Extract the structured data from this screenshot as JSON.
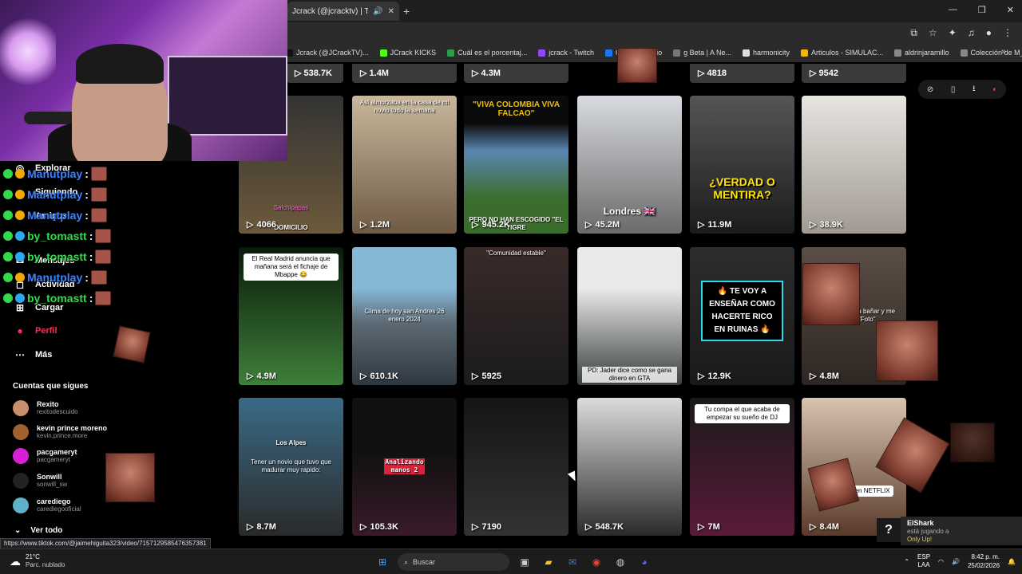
{
  "browser": {
    "tab_title": "Jcrack (@jcracktv) | TikTok",
    "bookmarks": [
      {
        "label": "Jcrack (@JCrackTV)...",
        "color": "#111111"
      },
      {
        "label": "JCrack KICKS",
        "color": "#53fc18"
      },
      {
        "label": "Cuál es el porcentaj...",
        "color": "#2a9d4a"
      },
      {
        "label": "jcrack - Twitch",
        "color": "#9146ff"
      },
      {
        "label": "Creator Studio",
        "color": "#1877f2"
      },
      {
        "label": "g Beta | A Ne...",
        "color": "#777777"
      },
      {
        "label": "harmonicity",
        "color": "#dddddd"
      },
      {
        "label": "Articulos - SIMULAC...",
        "color": "#f4b400"
      },
      {
        "label": "aldrinjaramillo",
        "color": "#888888"
      },
      {
        "label": "Colección de M_blei...",
        "color": "#888888"
      }
    ]
  },
  "chat": [
    {
      "user": "Manutplay",
      "color": "blue"
    },
    {
      "user": "Manutplay",
      "color": "blue"
    },
    {
      "user": "Manutplay",
      "color": "blue"
    },
    {
      "user": "by_tomastt",
      "color": "green"
    },
    {
      "user": "by_tomastt",
      "color": "green"
    },
    {
      "user": "Manutplay",
      "color": "blue"
    },
    {
      "user": "by_tomastt",
      "color": "green"
    }
  ],
  "chat_colon": ":",
  "nav": {
    "explorar": "Explorar",
    "siguiendo": "Siguiendo",
    "amigos": "Amigos",
    "mensajes": "Mensajes",
    "actividad": "Actividad",
    "cargar": "Cargar",
    "perfil": "Perfil",
    "mas": "Más"
  },
  "following": {
    "heading": "Cuentas que sigues",
    "accounts": [
      {
        "name": "Rexito",
        "user": "rexitodescuido",
        "color": "#c98f6a"
      },
      {
        "name": "kevin prince moreno",
        "user": "kevin.prince.more",
        "color": "#a0602f"
      },
      {
        "name": "pacgameryt",
        "user": "pacgameryt",
        "color": "#d61fd6"
      },
      {
        "name": "Sonwill",
        "user": "sonwill_sw",
        "color": "#222222"
      },
      {
        "name": "carediego",
        "user": "carediegooficial",
        "color": "#5fb0c8"
      }
    ],
    "see_all": "Ver todo"
  },
  "top_row_views": [
    "538.7K",
    "1.4M",
    "4.3M",
    "4818",
    "9542"
  ],
  "videos": [
    {
      "views": "4066",
      "caption": "Salchipapas",
      "caption2": "DOMICILIO"
    },
    {
      "views": "1.2M",
      "caption": "Así almorzaba en la casa de mi novio todo la semana"
    },
    {
      "views": "945.2K",
      "caption": "\"VIVA COLOMBIA VIVA FALCAO\"",
      "caption2": "PERO NO HAN ESCOGIDO \"EL TIGRE"
    },
    {
      "views": "45.2M",
      "caption": "Londres 🇬🇧"
    },
    {
      "views": "11.9M",
      "caption": "¿VERDAD O MENTIRA?"
    },
    {
      "views": "38.9K",
      "caption": ""
    },
    {
      "views": "4.9M",
      "caption": "El Real Madrid anuncia que mañana será el fichaje de Mbappe 😂"
    },
    {
      "views": "610.1K",
      "caption": "Clima de hoy san Andres 26 enero 2024"
    },
    {
      "views": "5925",
      "caption": "\"Comunidad estable\""
    },
    {
      "views": "",
      "caption": "PD: Jader dice como se gana dinero en GTA"
    },
    {
      "views": "12.9K",
      "caption": "🔥 TE VOY A ENSEÑAR COMO HACERTE RICO EN RUINAS 🔥"
    },
    {
      "views": "4.8M",
      "caption": "Me dijo que iba a bañar y me envió un \"Foto\""
    },
    {
      "views": "8.7M",
      "caption": "Tener un novio que tuvo que madurar muy rapido:",
      "sign": "Los Alpes"
    },
    {
      "views": "105.3K",
      "caption": "Analizando manos 2"
    },
    {
      "views": "7190",
      "caption": ""
    },
    {
      "views": "548.7K",
      "caption": ""
    },
    {
      "views": "7M",
      "caption": "Tu compa el que acaba de empezar su sueño de DJ"
    },
    {
      "views": "8.4M",
      "caption": "PELICULAS en NETFLIX"
    }
  ],
  "notification": {
    "title": "ElShark",
    "line2": "está jugando a",
    "game": "Only Up!"
  },
  "status_url": "https://www.tiktok.com/@jaimehiguita323/video/7157129585476357381",
  "taskbar": {
    "temp": "21°C",
    "weather": "Parc. nublado",
    "search_placeholder": "Buscar",
    "lang1": "ESP",
    "lang2": "LAA",
    "time": "8:42 p. m.",
    "date": "25/02/2026"
  },
  "colors": {
    "accent": "#fe2c55",
    "chat_blue": "#3d83ff",
    "chat_green": "#33d94a"
  }
}
